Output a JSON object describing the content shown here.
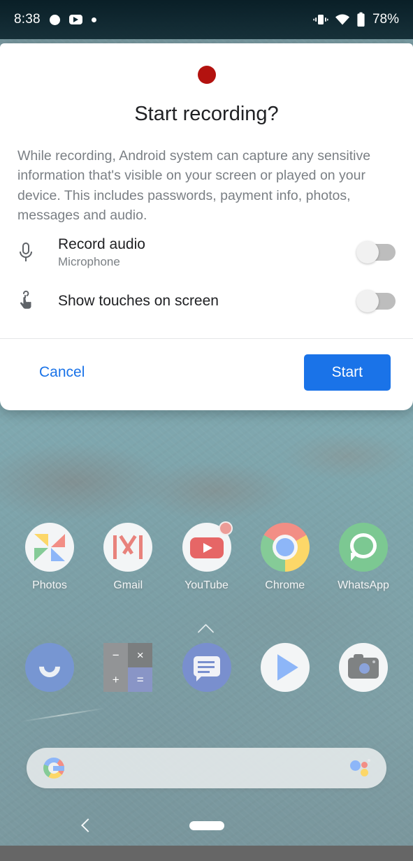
{
  "status_bar": {
    "clock": "8:38",
    "battery_percent": "78%",
    "left_icons": [
      "notification-circle-icon",
      "youtube-notification-icon",
      "notification-dot-icon"
    ],
    "right_icons": [
      "vibrate-icon",
      "wifi-icon",
      "battery-icon"
    ]
  },
  "dialog": {
    "record_icon": "record-dot-icon",
    "title": "Start recording?",
    "body": "While recording, Android system can capture any sensitive information that's visible on your screen or played on your device. This includes passwords, payment info, photos, messages and audio.",
    "options": [
      {
        "icon": "microphone-icon",
        "title": "Record audio",
        "subtitle": "Microphone",
        "toggle_state": "off"
      },
      {
        "icon": "touch-icon",
        "title": "Show touches on screen",
        "subtitle": "",
        "toggle_state": "off"
      }
    ],
    "cancel_label": "Cancel",
    "start_label": "Start"
  },
  "home_screen": {
    "app_row_1": [
      {
        "label": "Photos",
        "icon": "photos-icon"
      },
      {
        "label": "Gmail",
        "icon": "gmail-icon"
      },
      {
        "label": "YouTube",
        "icon": "youtube-icon",
        "badge": true
      },
      {
        "label": "Chrome",
        "icon": "chrome-icon"
      },
      {
        "label": "WhatsApp",
        "icon": "whatsapp-icon"
      }
    ],
    "dock": [
      {
        "label": "",
        "icon": "phone-icon"
      },
      {
        "label": "",
        "icon": "calculator-icon"
      },
      {
        "label": "",
        "icon": "messages-icon"
      },
      {
        "label": "",
        "icon": "play-store-icon"
      },
      {
        "label": "",
        "icon": "camera-icon"
      }
    ],
    "calculator_glyphs": [
      "−",
      "×",
      "+",
      "="
    ],
    "drawer_handle": "chevron-up-icon",
    "search_bar": {
      "logo": "google-g-icon",
      "assistant": "assistant-dots-icon",
      "placeholder": ""
    }
  },
  "nav_bar": {
    "back": "back-chevron-icon",
    "home": "home-pill-icon"
  },
  "colors": {
    "accent_blue": "#1a73e8",
    "record_red": "#b3120f",
    "dialog_bg": "#ffffff",
    "title_text": "#202124",
    "body_text": "#7a7f84",
    "wallpaper_teal": "#2d7380"
  }
}
